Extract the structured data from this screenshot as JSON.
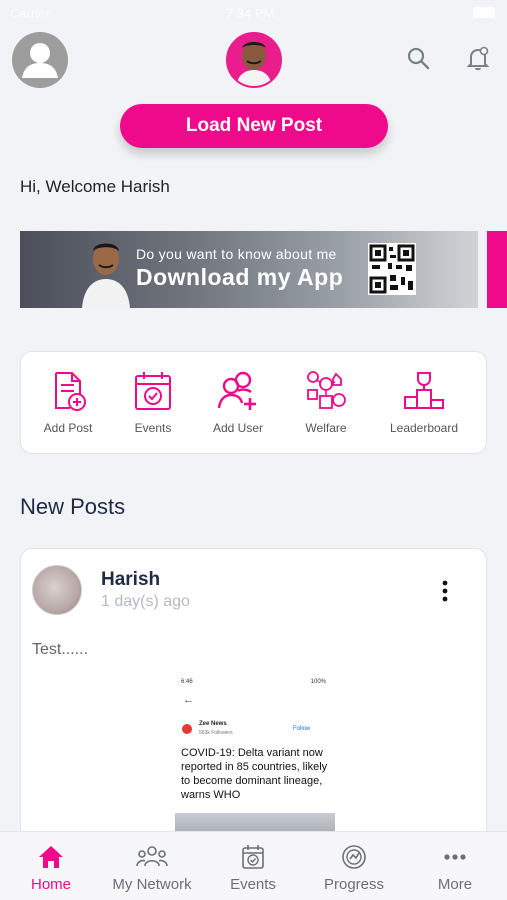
{
  "status_bar": {
    "carrier": "Carrier",
    "time": "7:34 PM"
  },
  "header": {
    "user_avatar_icon": "user-avatar-icon",
    "leader_photo": "leader-photo",
    "search_icon": "search-icon",
    "notification_icon": "bell-icon"
  },
  "load_button": {
    "label": "Load New Post"
  },
  "welcome_text": "Hi, Welcome Harish",
  "banner": {
    "line1": "Do you want to know about me",
    "line2": "Download my App"
  },
  "quick_actions": [
    {
      "label": "Add Post",
      "icon": "add-document-icon"
    },
    {
      "label": "Events",
      "icon": "calendar-check-icon"
    },
    {
      "label": "Add User",
      "icon": "add-user-icon"
    },
    {
      "label": "Welfare",
      "icon": "welfare-icon"
    },
    {
      "label": "Leaderboard",
      "icon": "podium-icon"
    }
  ],
  "section_title": "New Posts",
  "post": {
    "author": "Harish",
    "time": "1 day(s) ago",
    "text": "Test......",
    "embedded_screenshot": {
      "status_time": "6:46",
      "status_right": "100%",
      "source_name": "Zee News",
      "followers": "563k Followers",
      "follow_label": "Follow",
      "headline": "COVID-19: Delta variant now reported in 85 countries, likely to become dominant lineage, warns WHO"
    }
  },
  "tabs": [
    {
      "label": "Home",
      "icon": "home-icon",
      "active": true
    },
    {
      "label": "My Network",
      "icon": "network-icon",
      "active": false
    },
    {
      "label": "Events",
      "icon": "calendar-check-icon",
      "active": false
    },
    {
      "label": "Progress",
      "icon": "progress-icon",
      "active": false
    },
    {
      "label": "More",
      "icon": "more-dots-icon",
      "active": false
    }
  ],
  "colors": {
    "accent": "#ee0a8a",
    "text_dark": "#1f2a44"
  }
}
